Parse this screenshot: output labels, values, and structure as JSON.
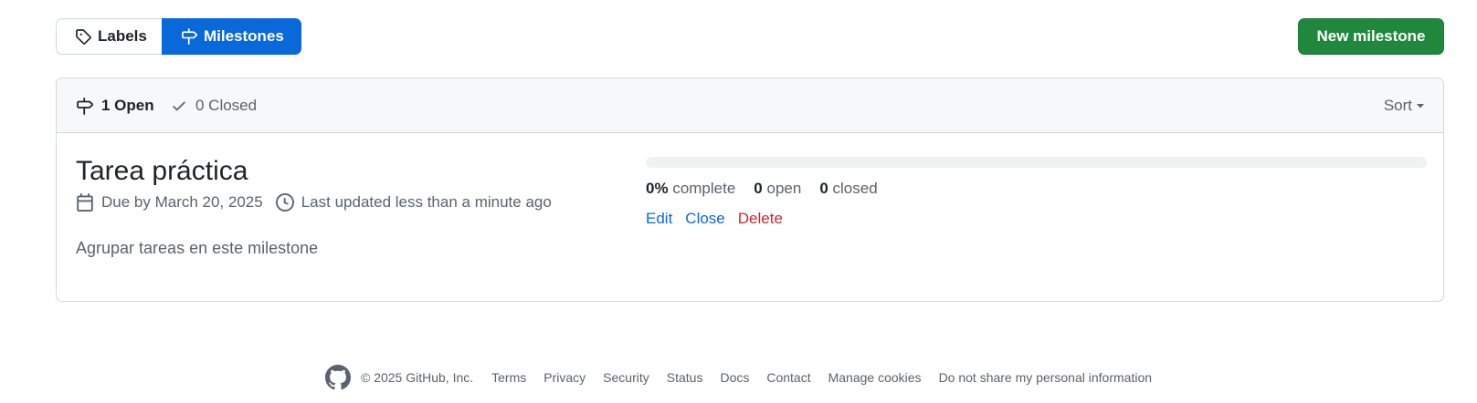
{
  "subnav": {
    "labels": {
      "label": "Labels",
      "icon": "tag-icon"
    },
    "milestones": {
      "label": "Milestones",
      "icon": "milestone-icon",
      "active": true
    }
  },
  "new_milestone_label": "New milestone",
  "states": {
    "open_label": "1 Open",
    "closed_label": "0 Closed",
    "sort_label": "Sort"
  },
  "milestone": {
    "title": "Tarea práctica",
    "due": "Due by March 20, 2025",
    "updated": "Last updated less than a minute ago",
    "description": "Agrupar tareas en este milestone",
    "progress_percent": 0,
    "percent_value": "0%",
    "percent_label": "complete",
    "open_count": "0",
    "open_label": "open",
    "closed_count": "0",
    "closed_label": "closed",
    "actions": {
      "edit": "Edit",
      "close": "Close",
      "delete": "Delete"
    }
  },
  "footer": {
    "copyright": "© 2025 GitHub, Inc.",
    "links": [
      "Terms",
      "Privacy",
      "Security",
      "Status",
      "Docs",
      "Contact",
      "Manage cookies",
      "Do not share my personal information"
    ]
  },
  "colors": {
    "primary_blue": "#0969da",
    "success_green": "#1f883d",
    "danger_red": "#d1242f",
    "muted_text": "#59636e"
  }
}
